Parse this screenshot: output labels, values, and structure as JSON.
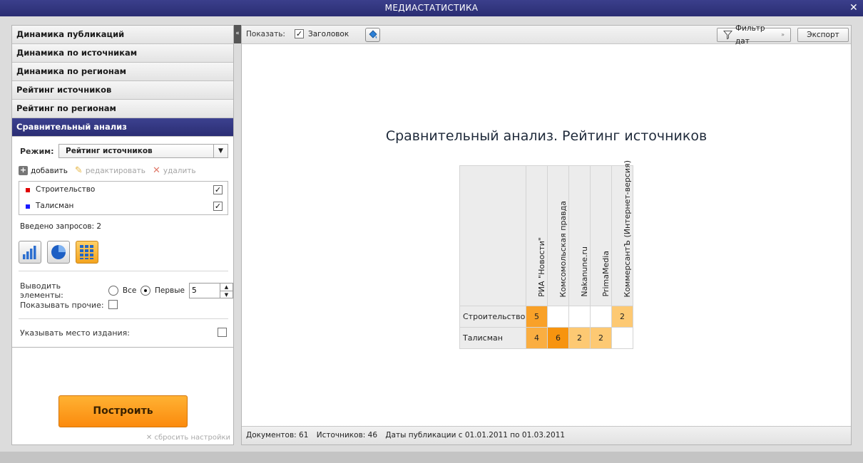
{
  "window": {
    "title": "МЕДИАСТАТИСТИКА",
    "close_glyph": "✕"
  },
  "sidebar": {
    "items": [
      {
        "label": "Динамика публикаций"
      },
      {
        "label": "Динамика по источникам"
      },
      {
        "label": "Динамика по регионам"
      },
      {
        "label": "Рейтинг источников"
      },
      {
        "label": "Рейтинг по регионам"
      },
      {
        "label": "Сравнительный анализ",
        "active": true
      }
    ],
    "collapse_glyph": "«",
    "mode_label": "Режим:",
    "mode_value": "Рейтинг источников",
    "actions": {
      "add": "добавить",
      "edit": "редактировать",
      "delete": "удалить"
    },
    "queries": [
      {
        "name": "Строительство",
        "color": "#e00000",
        "checked": true
      },
      {
        "name": "Талисман",
        "color": "#1a1aff",
        "checked": true
      }
    ],
    "query_count": "Введено запросов: 2",
    "viz_buttons": [
      "bar-chart-icon",
      "pie-chart-icon",
      "table-grid-icon"
    ],
    "output_label": "Выводить элементы:",
    "radio_all": "Все",
    "radio_first": "Первые",
    "first_count": "5",
    "show_other": "Показывать прочие:",
    "show_place": "Указывать место издания:",
    "build_button": "Построить",
    "reset": "сбросить настройки"
  },
  "toolbar": {
    "show_label": "Показать:",
    "header_label": "Заголовок",
    "header_checked": true,
    "date_filter": "Фильтр дат",
    "export": "Экспорт"
  },
  "report": {
    "title": "Сравнительный анализ. Рейтинг источников"
  },
  "chart_data": {
    "type": "table",
    "columns": [
      "РИА \"Новости\"",
      "Комсомольская правда",
      "Nakanune.ru",
      "PrimaMedia",
      "КоммерсантЪ (Интернет-версия)"
    ],
    "rows": [
      {
        "name": "Строительство",
        "values": [
          5,
          null,
          null,
          null,
          2
        ]
      },
      {
        "name": "Талисман",
        "values": [
          4,
          6,
          2,
          2,
          null
        ]
      }
    ]
  },
  "status": {
    "documents": "Документов: 61",
    "sources": "Источников: 46",
    "dates": "Даты публикации с 01.01.2011 по 01.03.2011"
  }
}
